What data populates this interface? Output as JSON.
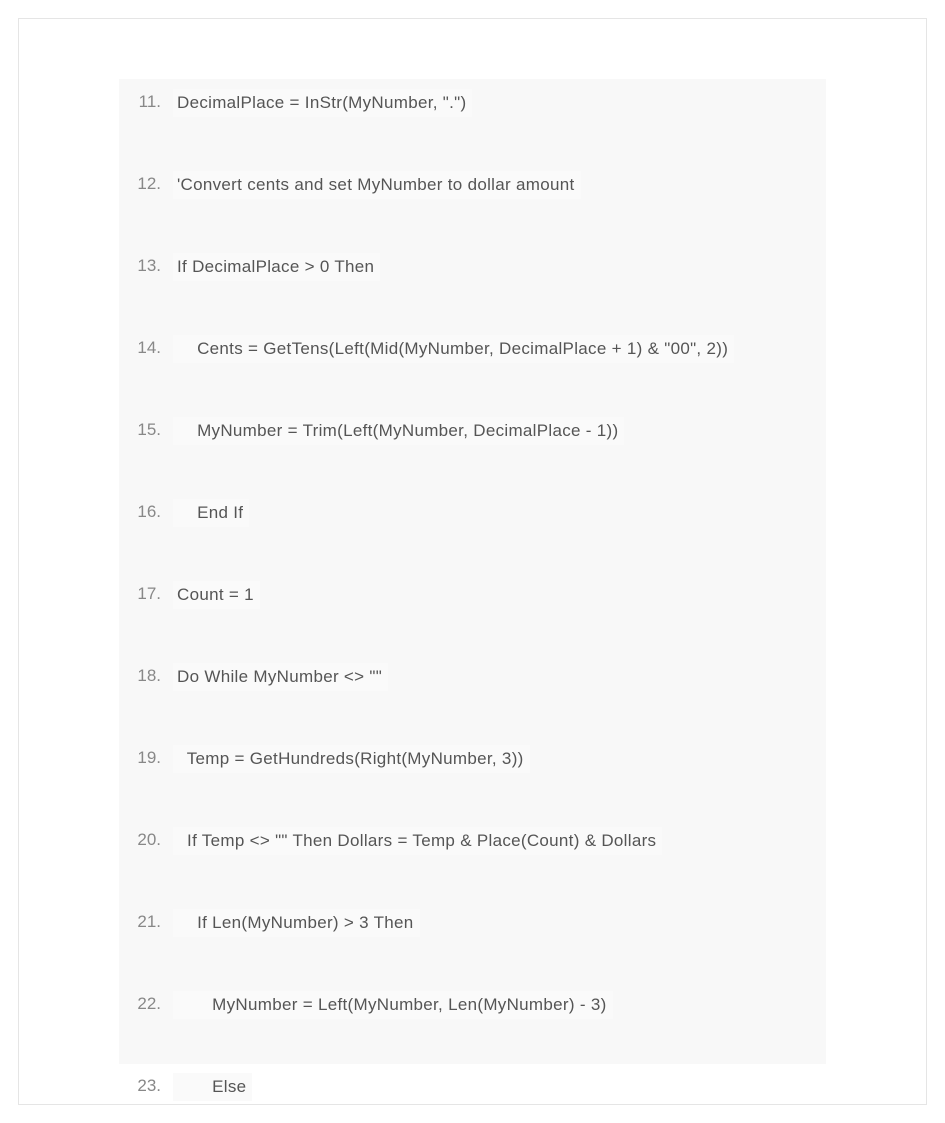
{
  "lines": {
    "l11": {
      "num": "11.",
      "code": "DecimalPlace = InStr(MyNumber, \".\")"
    },
    "l12": {
      "num": "12.",
      "code": "'Convert cents and set MyNumber to dollar amount"
    },
    "l13": {
      "num": "13.",
      "code": "If DecimalPlace > 0 Then"
    },
    "l14": {
      "num": "14.",
      "code": "    Cents = GetTens(Left(Mid(MyNumber, DecimalPlace + 1) & \"00\", 2))"
    },
    "l15": {
      "num": "15.",
      "code": "    MyNumber = Trim(Left(MyNumber, DecimalPlace - 1))"
    },
    "l16": {
      "num": "16.",
      "code": "    End If"
    },
    "l17": {
      "num": "17.",
      "code": "Count = 1"
    },
    "l18": {
      "num": "18.",
      "code": "Do While MyNumber <> \"\""
    },
    "l19": {
      "num": "19.",
      "code": "  Temp = GetHundreds(Right(MyNumber, 3))"
    },
    "l20": {
      "num": "20.",
      "code": "  If Temp <> \"\" Then Dollars = Temp & Place(Count) & Dollars"
    },
    "l21": {
      "num": "21.",
      "code": "    If Len(MyNumber) > 3 Then"
    },
    "l22": {
      "num": "22.",
      "code": "       MyNumber = Left(MyNumber, Len(MyNumber) - 3)"
    },
    "l23": {
      "num": "23.",
      "code": "       Else"
    }
  }
}
